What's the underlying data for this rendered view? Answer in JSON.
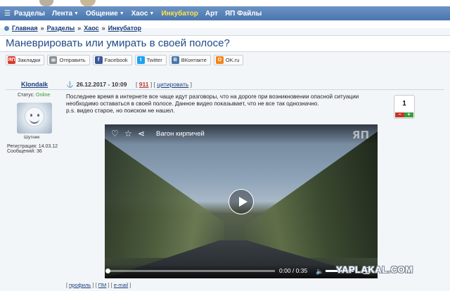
{
  "nav": {
    "items": [
      {
        "label": "Разделы",
        "caret": false,
        "highlight": false
      },
      {
        "label": "Лента",
        "caret": true,
        "highlight": false
      },
      {
        "label": "Общение",
        "caret": true,
        "highlight": false
      },
      {
        "label": "Хаос",
        "caret": true,
        "highlight": false
      },
      {
        "label": "Инкубатор",
        "caret": false,
        "highlight": true
      },
      {
        "label": "Арт",
        "caret": false,
        "highlight": false
      },
      {
        "label": "ЯП Файлы",
        "caret": false,
        "highlight": false
      }
    ]
  },
  "breadcrumb": {
    "items": [
      "Главная",
      "Разделы",
      "Хаос",
      "Инкубатор"
    ],
    "separator": "»"
  },
  "page": {
    "title": "Маневрировать или умирать в своей полосе?"
  },
  "share": {
    "buttons": [
      {
        "label": "Закладки",
        "icon": "ЯП",
        "color": "#d63a2a"
      },
      {
        "label": "Отправить",
        "icon": "✉",
        "color": "#8a8f96"
      },
      {
        "label": "Facebook",
        "icon": "f",
        "color": "#3b5998"
      },
      {
        "label": "Twitter",
        "icon": "t",
        "color": "#1da1f2"
      },
      {
        "label": "ВКонтакте",
        "icon": "В",
        "color": "#4a76a8"
      },
      {
        "label": "OK.ru",
        "icon": "О",
        "color": "#f2841c"
      }
    ]
  },
  "post": {
    "author": "Klondaik",
    "date": "26.12.2017 - 10:09",
    "number": "911",
    "cite": "цитировать",
    "text_lines": [
      "Последнее время в интернете все чаще идут разговоры, что на дороге при возникновении опасной ситуации",
      "необходимо оставаться в своей полосе. Данное видео показывает, что не все так однозначно.",
      "p.s. видео старое, но поиском не нашел."
    ],
    "rating": "1",
    "rating_minus": "−",
    "rating_plus": "+"
  },
  "user": {
    "status_label": "Статус:",
    "status_value": "Online",
    "rank": "Шутник",
    "registration": "Регистрация: 14.03.12",
    "messages": "Сообщений: 36",
    "links": [
      "профиль",
      "ПМ",
      "e-mail"
    ]
  },
  "video": {
    "title": "Вагон кирпичей",
    "logo": "ЯП",
    "time": "0:00 / 0:35",
    "progress": 0
  },
  "watermark": "YAPLAKAL.COM"
}
